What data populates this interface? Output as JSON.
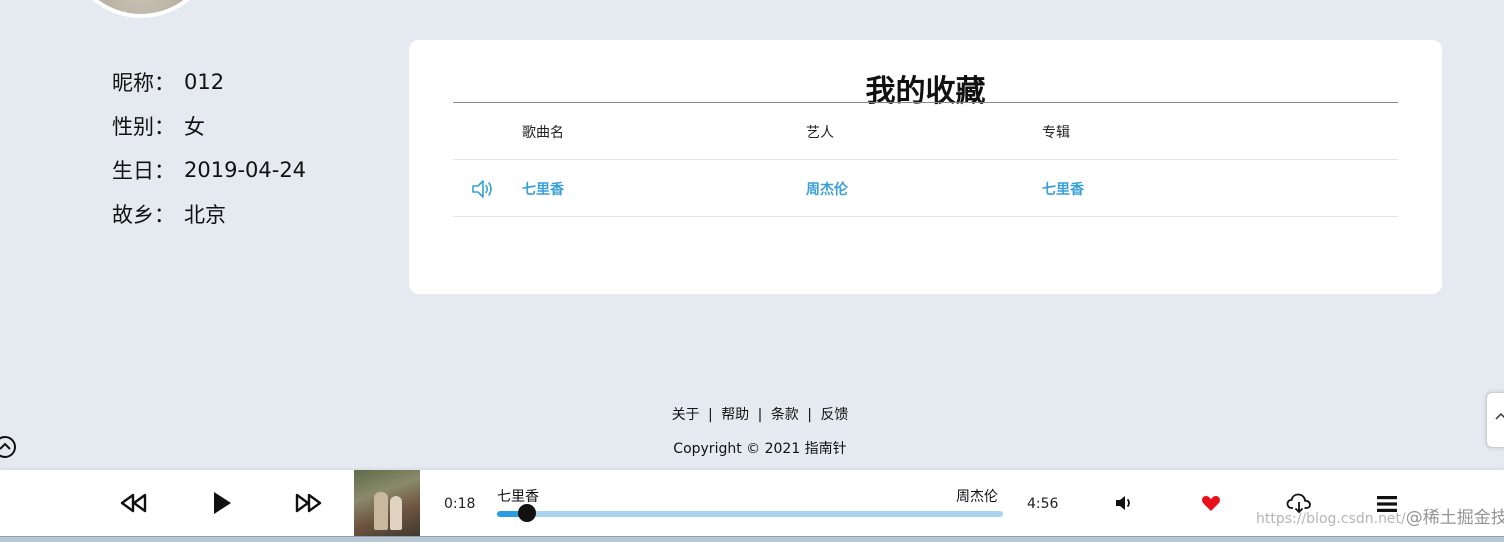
{
  "profile": {
    "nickname_label": "昵称：",
    "nickname": "012",
    "gender_label": "性别：",
    "gender": "女",
    "birthday_label": "生日：",
    "birthday": "2019-04-24",
    "hometown_label": "故乡：",
    "hometown": "北京"
  },
  "favorites": {
    "title": "我的收藏",
    "columns": [
      "歌曲名",
      "艺人",
      "专辑"
    ],
    "rows": [
      {
        "song": "七里香",
        "artist": "周杰伦",
        "album": "七里香",
        "icon": "speaker-icon"
      }
    ]
  },
  "footer": {
    "links": [
      "关于",
      "帮助",
      "条款",
      "反馈"
    ],
    "separator": "|",
    "copyright": "Copyright © 2021 指南针"
  },
  "player": {
    "elapsed": "0:18",
    "duration": "4:56",
    "song_title": "七里香",
    "artist": "周杰伦",
    "progress_fraction": 0.06,
    "liked": true,
    "accent_color": "#2a9de0",
    "like_color": "#e8101a",
    "icons": [
      "rewind-icon",
      "play-icon",
      "fast-forward-icon",
      "volume-icon",
      "heart-icon",
      "cloud-download-icon",
      "menu-icon"
    ]
  },
  "watermark": {
    "url": "https://blog.csdn.net/",
    "text": "@稀土掘金技术社区"
  }
}
